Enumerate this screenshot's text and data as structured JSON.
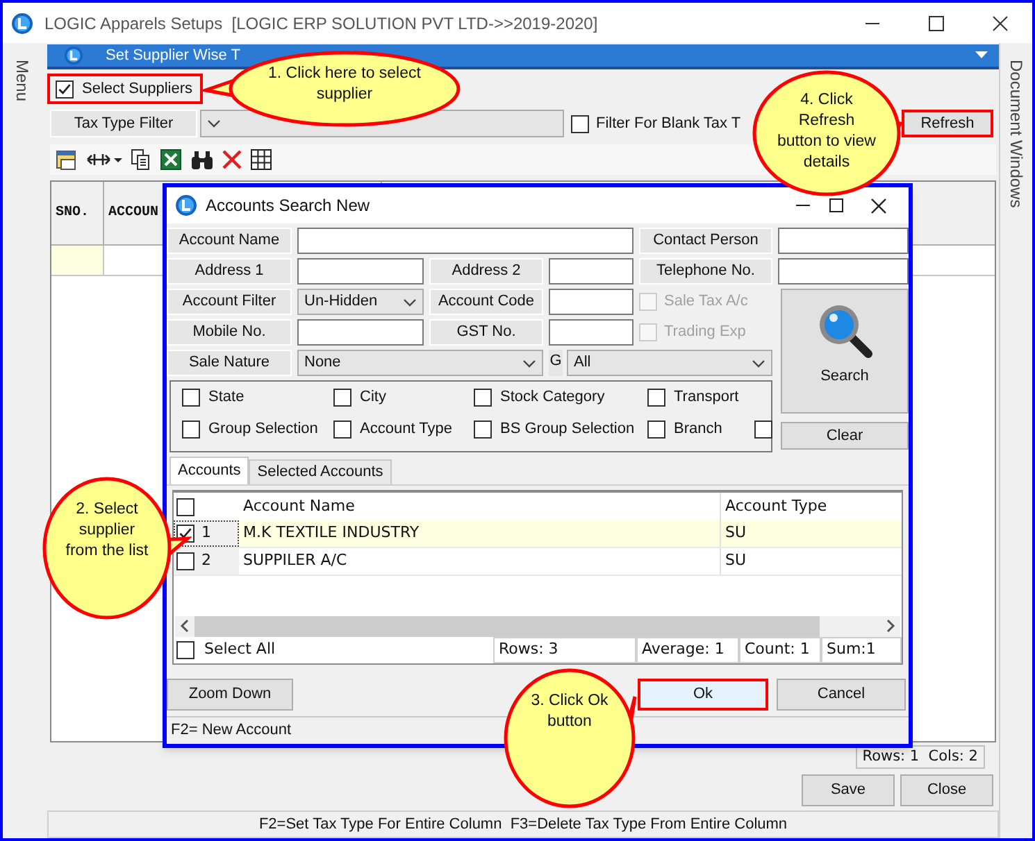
{
  "window": {
    "title": "LOGIC Apparels Setups  [LOGIC ERP SOLUTION PVT LTD->>2019-2020]"
  },
  "side_panels": {
    "left": "Menu",
    "right": "Document Windows"
  },
  "document_tab": {
    "title": "Set Supplier Wise T"
  },
  "select_suppliers": {
    "label": "Select Suppliers",
    "checked": true,
    "annotated": true
  },
  "filter_bar": {
    "label": "Tax Type Filter",
    "blank_filter": {
      "label": "Filter For Blank Tax T",
      "checked": false
    },
    "refresh": {
      "label": "Refresh",
      "annotated": true
    }
  },
  "grid": {
    "columns": [
      "SNO.",
      "ACCOUN"
    ]
  },
  "grid_status": "Rows: 1  Cols: 2",
  "buttons": [
    {
      "label": "Save"
    },
    {
      "label": "Close"
    }
  ],
  "status_bar": "F2=Set Tax Type For Entire Column  F3=Delete Tax Type From Entire Column",
  "dialog": {
    "title": "Accounts Search New",
    "form": {
      "account_name": "Account Name",
      "contact_person": "Contact Person",
      "address_1": "Address 1",
      "address_2": "Address 2",
      "telephone": "Telephone No.",
      "account_filter": {
        "label": "Account Filter",
        "value": "Un-Hidden"
      },
      "account_code": "Account Code",
      "sale_tax": {
        "label": "Sale Tax A/c",
        "checked": false,
        "disabled": true
      },
      "mobile": "Mobile No.",
      "gst": "GST No.",
      "trading_exp": {
        "label": "Trading Exp",
        "checked": false,
        "disabled": true
      },
      "sale_nature": {
        "label": "Sale Nature",
        "value": "None"
      },
      "group_filter": {
        "label": "G",
        "value": "All"
      },
      "search_button": "Search",
      "clear_button": "Clear"
    },
    "filter_options": [
      [
        {
          "label": "State",
          "checked": false
        },
        {
          "label": "City",
          "checked": false
        },
        {
          "label": "Stock Category",
          "checked": false
        },
        {
          "label": "Transport",
          "checked": false
        }
      ],
      [
        {
          "label": "Group Selection",
          "checked": false
        },
        {
          "label": "Account Type",
          "checked": false
        },
        {
          "label": "BS Group Selection",
          "checked": false
        },
        {
          "label": "Branch",
          "checked": false
        },
        {
          "checked": false
        }
      ]
    ],
    "tabs": [
      {
        "label": "Accounts",
        "selected": true
      },
      {
        "label": "Selected Accounts",
        "selected": false
      }
    ],
    "accounts": {
      "header_checked": false,
      "columns": [
        "Account Name",
        "Account Type"
      ],
      "rows": [
        {
          "sno": "1",
          "name": "M.K TEXTILE INDUSTRY",
          "type": "SU",
          "checked": true,
          "selected": true
        },
        {
          "sno": "2",
          "name": "SUPPILER A/C",
          "type": "SU",
          "checked": false,
          "selected": false
        }
      ]
    },
    "select_all": {
      "label": "Select All",
      "checked": false
    },
    "summary": [
      "Rows: 3",
      "Average: 1",
      "Count: 1",
      "Sum:1"
    ],
    "zoom_button": "Zoom Down",
    "ok_button": {
      "label": "Ok",
      "annotated": true
    },
    "cancel_button": "Cancel",
    "status": "F2= New Account"
  },
  "callouts": [
    {
      "text": "1. Click here to select supplier"
    },
    {
      "text": "2. Select supplier from the list"
    },
    {
      "text": "3. Click Ok button"
    },
    {
      "text": "4. Click Refresh button to view details"
    }
  ]
}
